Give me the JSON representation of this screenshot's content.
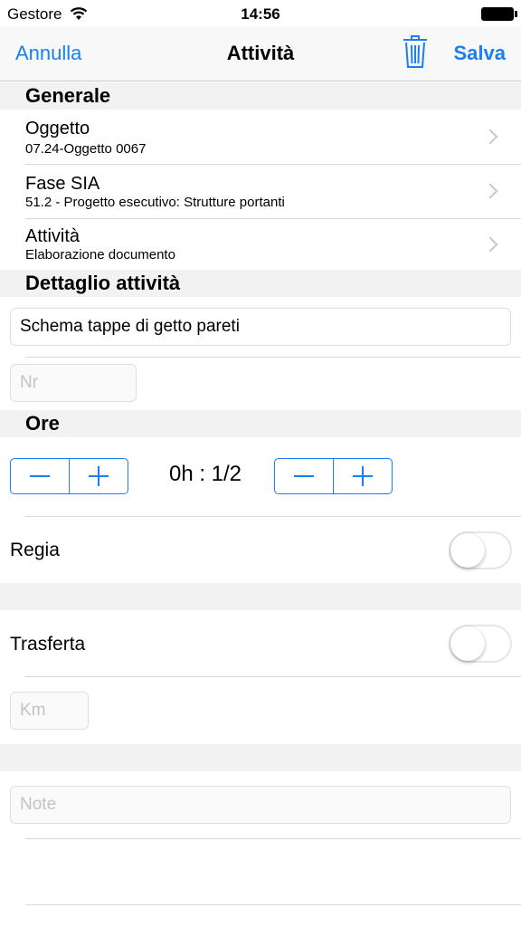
{
  "status_bar": {
    "carrier": "Gestore",
    "time": "14:56",
    "wifi_icon": "wifi-icon",
    "battery_icon": "battery-icon"
  },
  "nav": {
    "cancel_label": "Annulla",
    "title": "Attività",
    "trash_icon": "trash-icon",
    "save_label": "Salva",
    "accent_color": "#1a7ff0"
  },
  "general": {
    "header": "Generale",
    "rows": [
      {
        "title": "Oggetto",
        "subtitle": "07.24-Oggetto 0067"
      },
      {
        "title": "Fase SIA",
        "subtitle": "51.2 - Progetto esecutivo: Strutture portanti"
      },
      {
        "title": "Attività",
        "subtitle": "Elaborazione documento"
      }
    ]
  },
  "detail": {
    "header": "Dettaglio attività",
    "description_value": "Schema tappe di getto pareti",
    "nr_placeholder": "Nr"
  },
  "hours": {
    "header": "Ore",
    "value": "0h : 1/2"
  },
  "regia": {
    "label": "Regia",
    "on": false
  },
  "trasferta": {
    "label": "Trasferta",
    "on": false
  },
  "km_placeholder": "Km",
  "notes_placeholder": "Note"
}
